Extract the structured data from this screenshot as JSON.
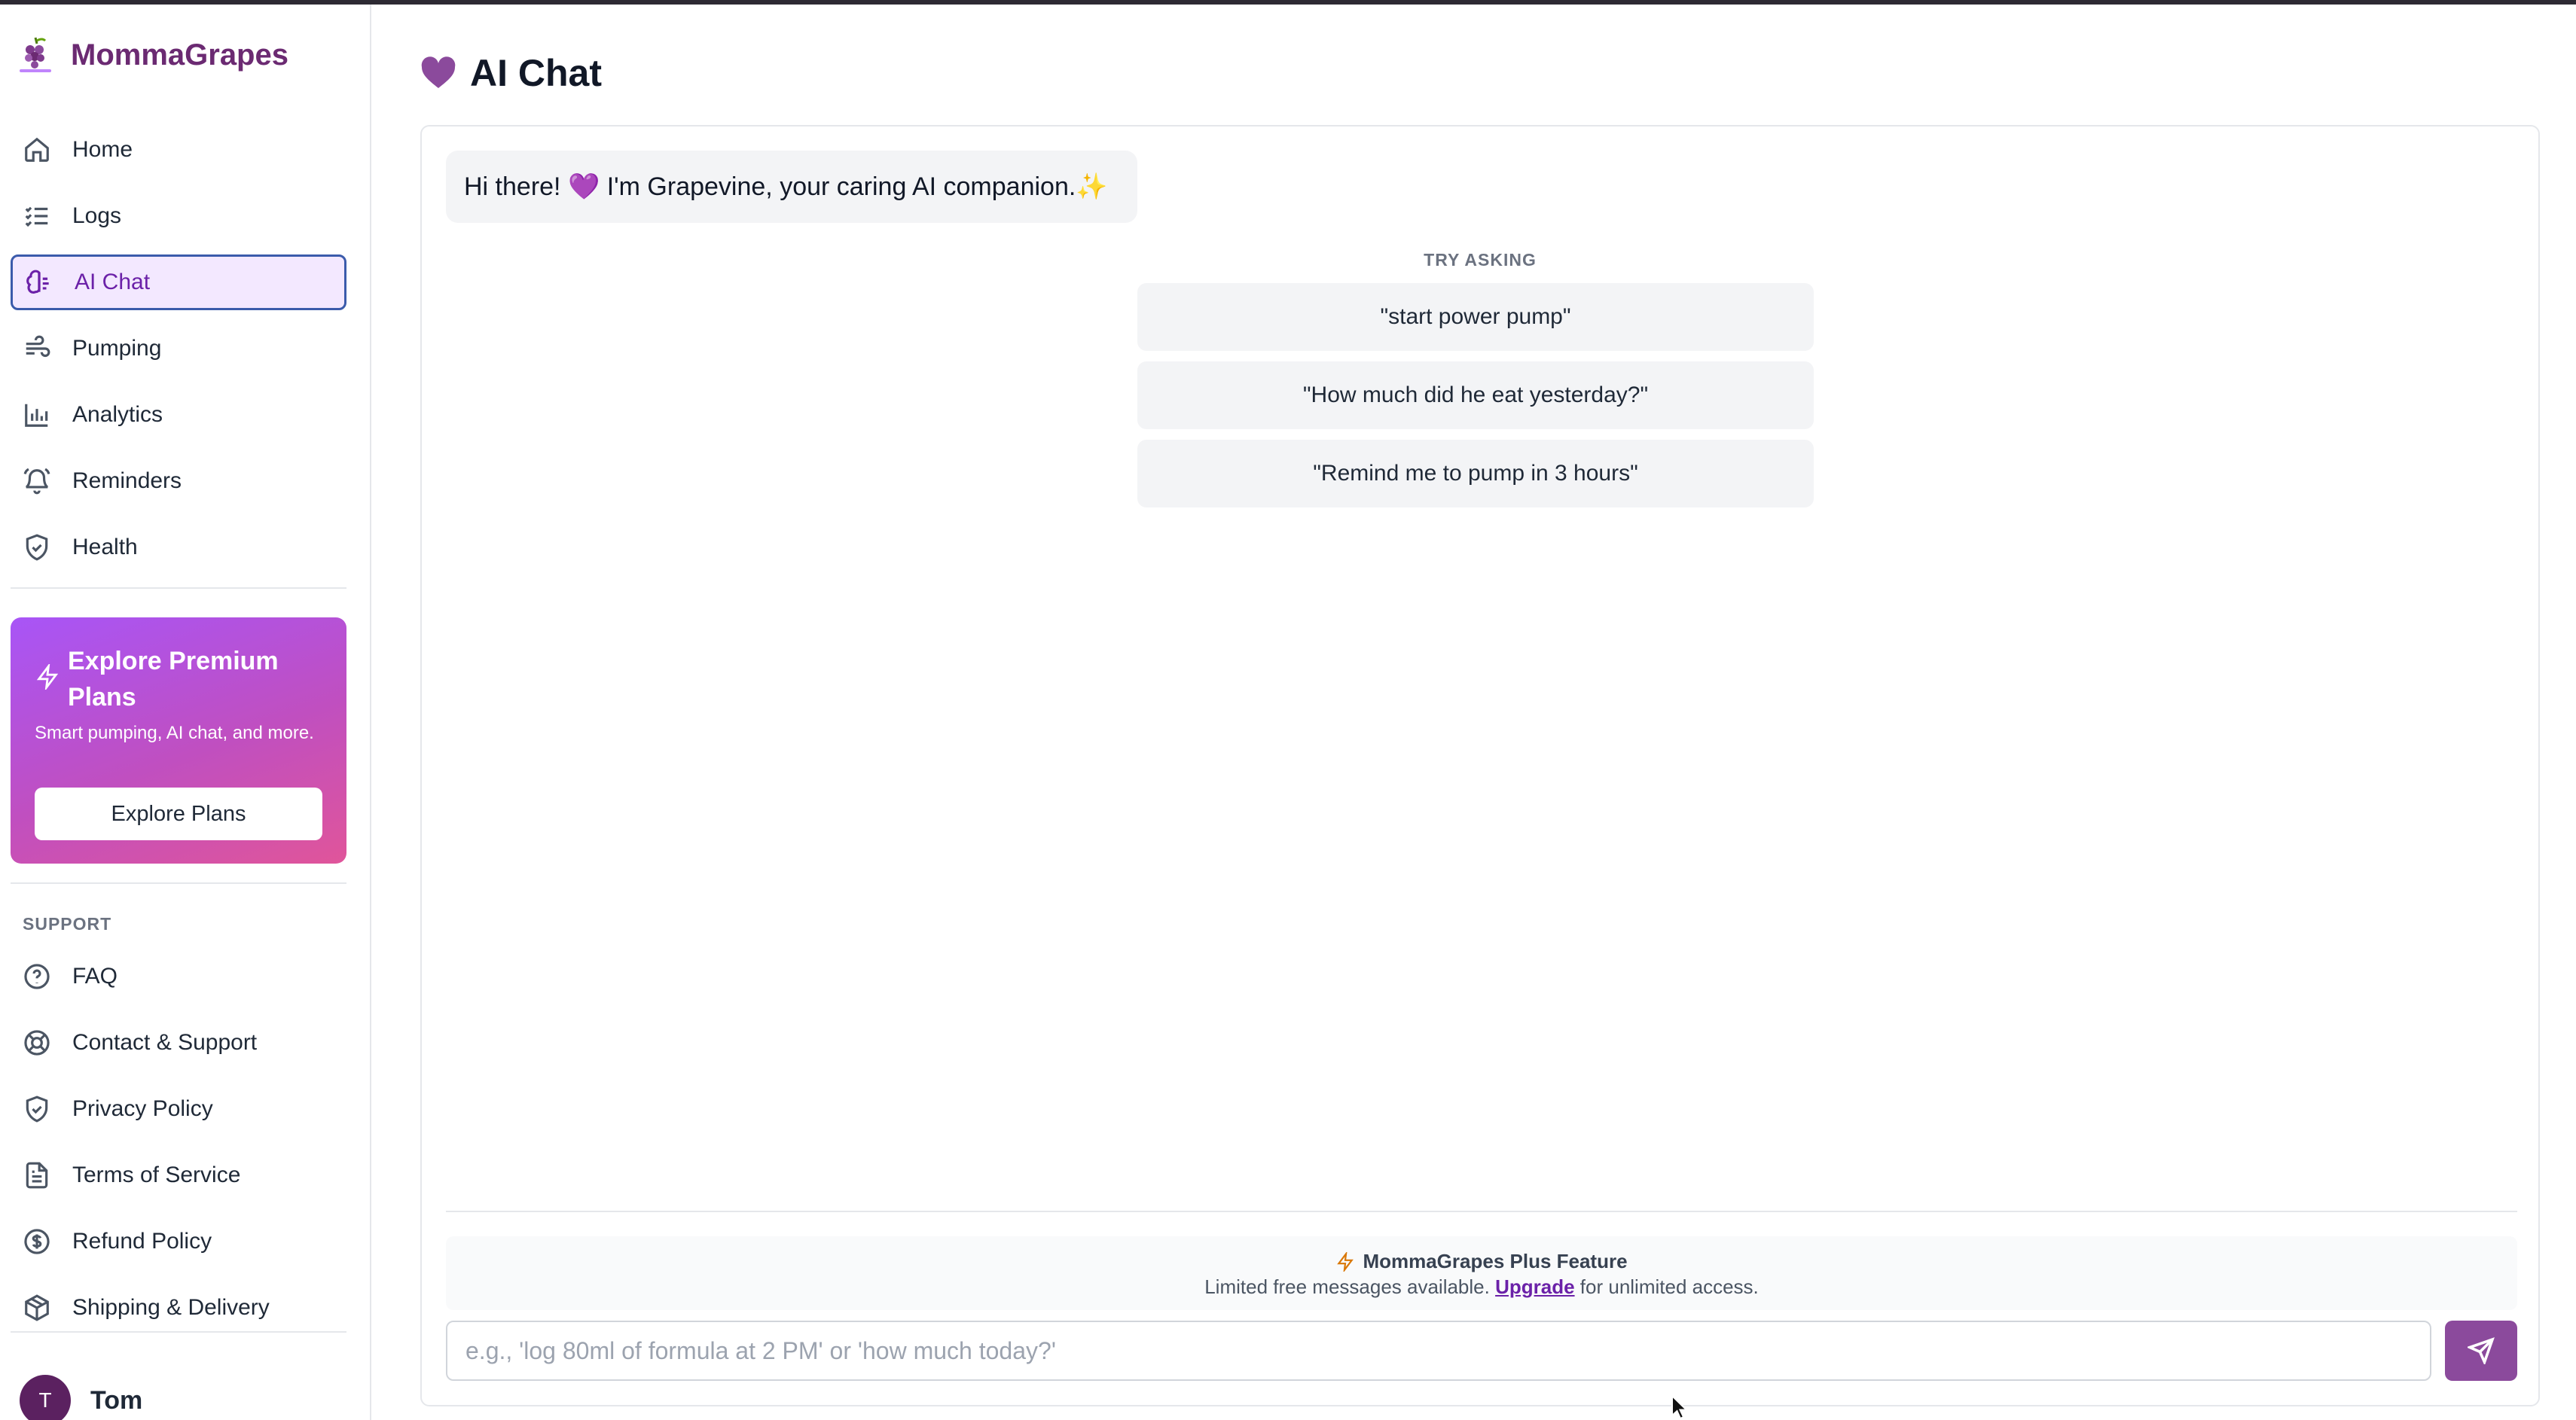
{
  "app": {
    "name": "MommaGrapes"
  },
  "sidebar": {
    "items": [
      {
        "label": "Home",
        "icon": "home-icon",
        "active": false
      },
      {
        "label": "Logs",
        "icon": "list-icon",
        "active": false
      },
      {
        "label": "AI Chat",
        "icon": "brain-icon",
        "active": true
      },
      {
        "label": "Pumping",
        "icon": "wind-icon",
        "active": false
      },
      {
        "label": "Analytics",
        "icon": "bar-chart-icon",
        "active": false
      },
      {
        "label": "Reminders",
        "icon": "bell-icon",
        "active": false
      },
      {
        "label": "Health",
        "icon": "shield-check-icon",
        "active": false
      }
    ],
    "premium": {
      "title": "Explore Premium Plans",
      "text": "Smart pumping, AI chat, and more.",
      "button": "Explore Plans"
    },
    "support_label": "SUPPORT",
    "support_items": [
      {
        "label": "FAQ",
        "icon": "help-circle-icon"
      },
      {
        "label": "Contact & Support",
        "icon": "life-buoy-icon"
      },
      {
        "label": "Privacy Policy",
        "icon": "shield-check-icon"
      },
      {
        "label": "Terms of Service",
        "icon": "file-text-icon"
      },
      {
        "label": "Refund Policy",
        "icon": "dollar-circle-icon"
      },
      {
        "label": "Shipping & Delivery",
        "icon": "package-icon"
      }
    ],
    "user": {
      "initial": "T",
      "name": "Tom"
    }
  },
  "main": {
    "title": "AI Chat",
    "greeting": "Hi there! 💜 I'm Grapevine, your caring AI companion.✨",
    "try_label": "TRY ASKING",
    "suggestions": [
      "\"start power pump\"",
      "\"How much did he eat yesterday?\"",
      "\"Remind me to pump in 3 hours\""
    ],
    "notice": {
      "title": "MommaGrapes Plus Feature",
      "text_before": "Limited free messages available.",
      "link": "Upgrade",
      "text_after": "for unlimited access."
    },
    "input": {
      "value": "",
      "placeholder": "e.g., 'log 80ml of formula at 2 PM' or 'how much today?'"
    }
  },
  "colors": {
    "brand": "#6b2a72",
    "accent": "#8b4a9c",
    "active_bg": "#f3e8ff",
    "premium_gradient_start": "#a855f7",
    "premium_gradient_end": "#e0559a"
  }
}
